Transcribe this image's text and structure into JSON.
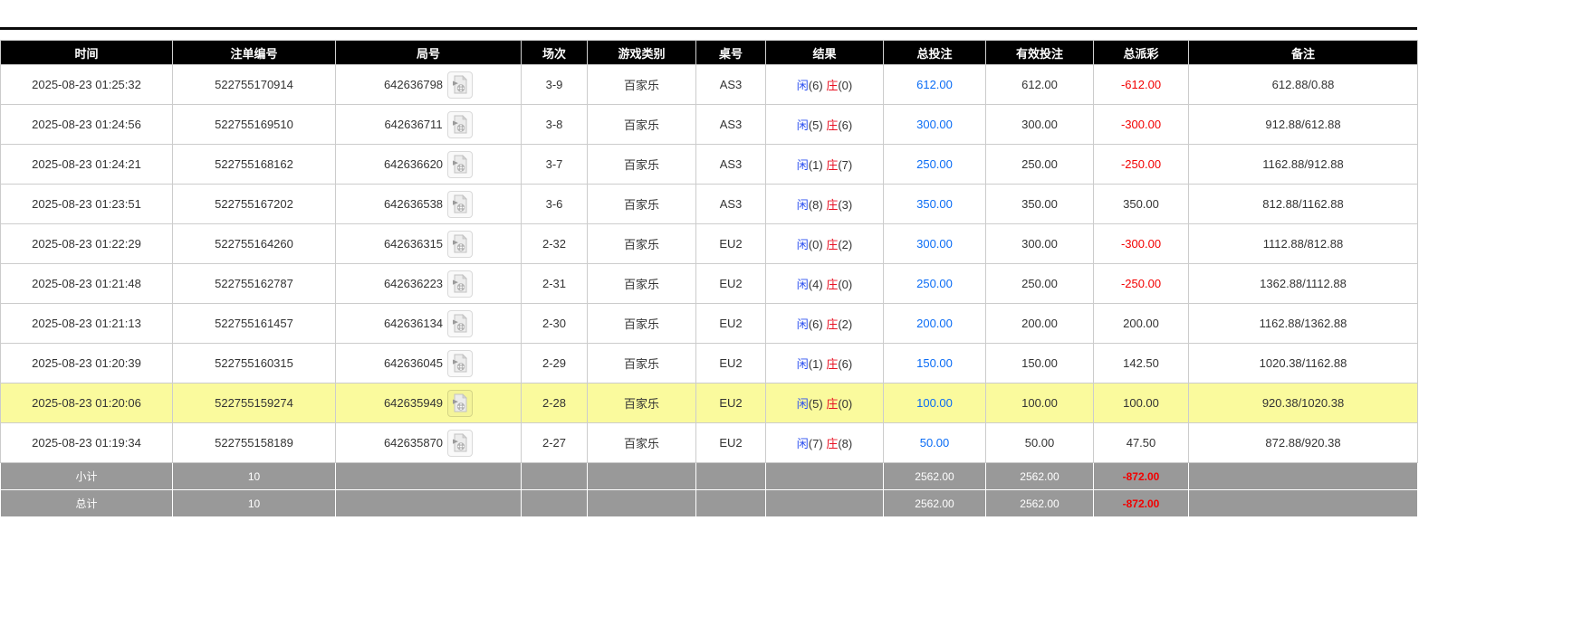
{
  "table": {
    "headers": [
      "时间",
      "注单编号",
      "局号",
      "场次",
      "游戏类别",
      "桌号",
      "结果",
      "总投注",
      "有效投注",
      "总派彩",
      "备注"
    ],
    "result_labels": {
      "player": "闲",
      "banker": "庄"
    },
    "rows": [
      {
        "time": "2025-08-23 01:25:32",
        "bet_id": "522755170914",
        "round_id": "642636798",
        "session": "3-9",
        "game": "百家乐",
        "table_no": "AS3",
        "player": 6,
        "banker": 0,
        "total_bet": "612.00",
        "valid_bet": "612.00",
        "payout": "-612.00",
        "remark": "612.88/0.88",
        "highlight": false
      },
      {
        "time": "2025-08-23 01:24:56",
        "bet_id": "522755169510",
        "round_id": "642636711",
        "session": "3-8",
        "game": "百家乐",
        "table_no": "AS3",
        "player": 5,
        "banker": 6,
        "total_bet": "300.00",
        "valid_bet": "300.00",
        "payout": "-300.00",
        "remark": "912.88/612.88",
        "highlight": false
      },
      {
        "time": "2025-08-23 01:24:21",
        "bet_id": "522755168162",
        "round_id": "642636620",
        "session": "3-7",
        "game": "百家乐",
        "table_no": "AS3",
        "player": 1,
        "banker": 7,
        "total_bet": "250.00",
        "valid_bet": "250.00",
        "payout": "-250.00",
        "remark": "1162.88/912.88",
        "highlight": false
      },
      {
        "time": "2025-08-23 01:23:51",
        "bet_id": "522755167202",
        "round_id": "642636538",
        "session": "3-6",
        "game": "百家乐",
        "table_no": "AS3",
        "player": 8,
        "banker": 3,
        "total_bet": "350.00",
        "valid_bet": "350.00",
        "payout": "350.00",
        "remark": "812.88/1162.88",
        "highlight": false
      },
      {
        "time": "2025-08-23 01:22:29",
        "bet_id": "522755164260",
        "round_id": "642636315",
        "session": "2-32",
        "game": "百家乐",
        "table_no": "EU2",
        "player": 0,
        "banker": 2,
        "total_bet": "300.00",
        "valid_bet": "300.00",
        "payout": "-300.00",
        "remark": "1112.88/812.88",
        "highlight": false
      },
      {
        "time": "2025-08-23 01:21:48",
        "bet_id": "522755162787",
        "round_id": "642636223",
        "session": "2-31",
        "game": "百家乐",
        "table_no": "EU2",
        "player": 4,
        "banker": 0,
        "total_bet": "250.00",
        "valid_bet": "250.00",
        "payout": "-250.00",
        "remark": "1362.88/1112.88",
        "highlight": false
      },
      {
        "time": "2025-08-23 01:21:13",
        "bet_id": "522755161457",
        "round_id": "642636134",
        "session": "2-30",
        "game": "百家乐",
        "table_no": "EU2",
        "player": 6,
        "banker": 2,
        "total_bet": "200.00",
        "valid_bet": "200.00",
        "payout": "200.00",
        "remark": "1162.88/1362.88",
        "highlight": false
      },
      {
        "time": "2025-08-23 01:20:39",
        "bet_id": "522755160315",
        "round_id": "642636045",
        "session": "2-29",
        "game": "百家乐",
        "table_no": "EU2",
        "player": 1,
        "banker": 6,
        "total_bet": "150.00",
        "valid_bet": "150.00",
        "payout": "142.50",
        "remark": "1020.38/1162.88",
        "highlight": false
      },
      {
        "time": "2025-08-23 01:20:06",
        "bet_id": "522755159274",
        "round_id": "642635949",
        "session": "2-28",
        "game": "百家乐",
        "table_no": "EU2",
        "player": 5,
        "banker": 0,
        "total_bet": "100.00",
        "valid_bet": "100.00",
        "payout": "100.00",
        "remark": "920.38/1020.38",
        "highlight": true
      },
      {
        "time": "2025-08-23 01:19:34",
        "bet_id": "522755158189",
        "round_id": "642635870",
        "session": "2-27",
        "game": "百家乐",
        "table_no": "EU2",
        "player": 7,
        "banker": 8,
        "total_bet": "50.00",
        "valid_bet": "50.00",
        "payout": "47.50",
        "remark": "872.88/920.38",
        "highlight": false
      }
    ],
    "footer_rows": [
      {
        "label": "小计",
        "count": "10",
        "total_bet": "2562.00",
        "valid_bet": "2562.00",
        "payout": "-872.00"
      },
      {
        "label": "总计",
        "count": "10",
        "total_bet": "2562.00",
        "valid_bet": "2562.00",
        "payout": "-872.00"
      }
    ]
  },
  "icons": {
    "video_icon": "video-replay"
  },
  "colors": {
    "header_bg": "#000000",
    "header_text": "#ffffff",
    "player_blue": "#2c50f0",
    "banker_red": "#e81123",
    "bet_amount_blue": "#0a6cf5",
    "negative_red": "#f20000",
    "highlight_row": "#fafa9d",
    "footer_bg": "#999999",
    "footer_text": "#ffffff"
  }
}
